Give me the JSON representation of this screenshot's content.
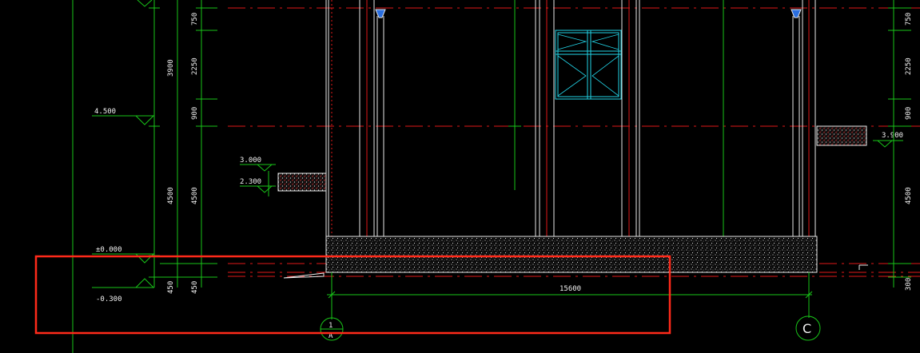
{
  "drawing": {
    "levels": {
      "l_4500": "4.500",
      "l_3000": "3.000",
      "l_2300": "2.300",
      "l_0000": "±0.000",
      "l_m0300": "-0.300",
      "l_3900": "3.900"
    },
    "dims_left_outer": {
      "d_3900": "3900",
      "d_4500": "4500",
      "d_450": "450"
    },
    "dims_left_inner": {
      "d_750": "750",
      "d_2250": "2250",
      "d_900": "900",
      "d_4500": "4500",
      "d_450": "450"
    },
    "dims_right": {
      "d_750": "750",
      "d_2250": "2250",
      "d_900": "900",
      "d_4500": "4500",
      "d_300": "300"
    },
    "span_dim": "15600",
    "axis_left": {
      "top": "1",
      "bottom": "A"
    },
    "axis_right": "C",
    "colors": {
      "background": "#000000",
      "axis_red": "#e01818",
      "dimension_green": "#19c419",
      "wall_white": "#e8e8e8",
      "window_cyan": "#22d3e6",
      "highlight_red": "#ff2a1a"
    }
  }
}
